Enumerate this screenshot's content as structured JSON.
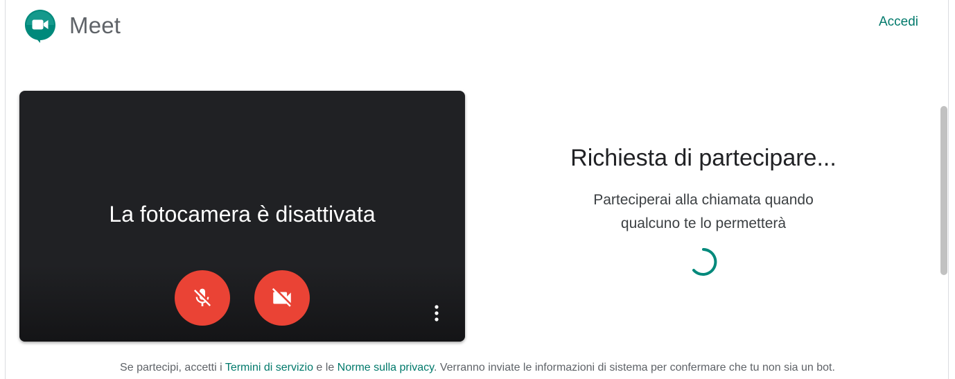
{
  "header": {
    "brand": "Meet",
    "signin_label": "Accedi"
  },
  "preview": {
    "camera_off_text": "La fotocamera è disattivata",
    "mic_icon": "mic-off-icon",
    "camera_icon": "videocam-off-icon",
    "more_icon": "more-vertical-icon"
  },
  "status": {
    "title": "Richiesta di partecipare...",
    "line1": "Parteciperai alla chiamata quando",
    "line2": "qualcuno te lo permetterà"
  },
  "footer": {
    "prefix": "Se partecipi, accetti i ",
    "terms_label": "Termini di servizio",
    "middle": " e le ",
    "privacy_label": "Norme sulla privacy",
    "suffix": ". Verranno inviate le informazioni di sistema per confermare che tu non sia un bot."
  },
  "colors": {
    "accent": "#00796b",
    "danger": "#ea4335",
    "preview_bg": "#202124"
  }
}
